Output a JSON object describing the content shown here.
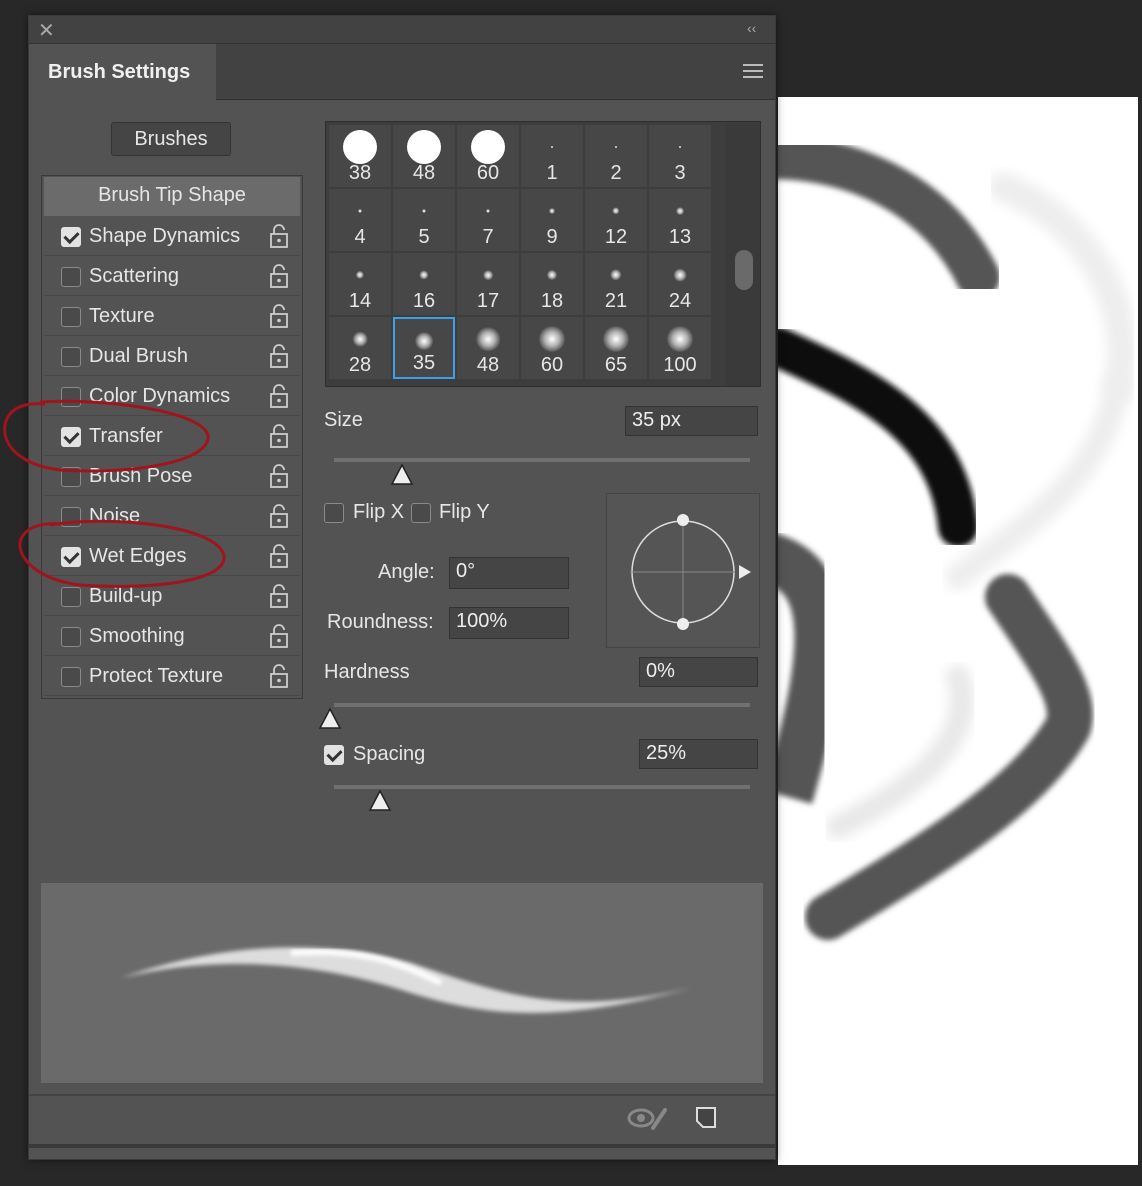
{
  "panel": {
    "title": "Brush Settings",
    "brushes_button": "Brushes"
  },
  "sidebar": {
    "header": "Brush Tip Shape",
    "items": [
      {
        "label": "Shape Dynamics",
        "checked": true
      },
      {
        "label": "Scattering",
        "checked": false
      },
      {
        "label": "Texture",
        "checked": false
      },
      {
        "label": "Dual Brush",
        "checked": false
      },
      {
        "label": "Color Dynamics",
        "checked": false
      },
      {
        "label": "Transfer",
        "checked": true
      },
      {
        "label": "Brush Pose",
        "checked": false
      },
      {
        "label": "Noise",
        "checked": false
      },
      {
        "label": "Wet Edges",
        "checked": true
      },
      {
        "label": "Build-up",
        "checked": false
      },
      {
        "label": "Smoothing",
        "checked": false
      },
      {
        "label": "Protect Texture",
        "checked": false
      }
    ]
  },
  "presets": {
    "sizes": [
      "38",
      "48",
      "60",
      "1",
      "2",
      "3",
      "4",
      "5",
      "7",
      "9",
      "12",
      "13",
      "14",
      "16",
      "17",
      "18",
      "21",
      "24",
      "28",
      "35",
      "48",
      "60",
      "65",
      "100"
    ],
    "selected": "35"
  },
  "controls": {
    "size_label": "Size",
    "size_value": "35 px",
    "size_slider_fraction": 0.1,
    "flip_x": "Flip X",
    "flip_y": "Flip Y",
    "angle_label": "Angle:",
    "angle_value": "0°",
    "roundness_label": "Roundness:",
    "roundness_value": "100%",
    "hardness_label": "Hardness",
    "hardness_value": "0%",
    "spacing_label": "Spacing",
    "spacing_value": "25%",
    "spacing_checked": true
  },
  "colors": {
    "accent": "#3aa0e8",
    "annotation": "#a0141e"
  }
}
